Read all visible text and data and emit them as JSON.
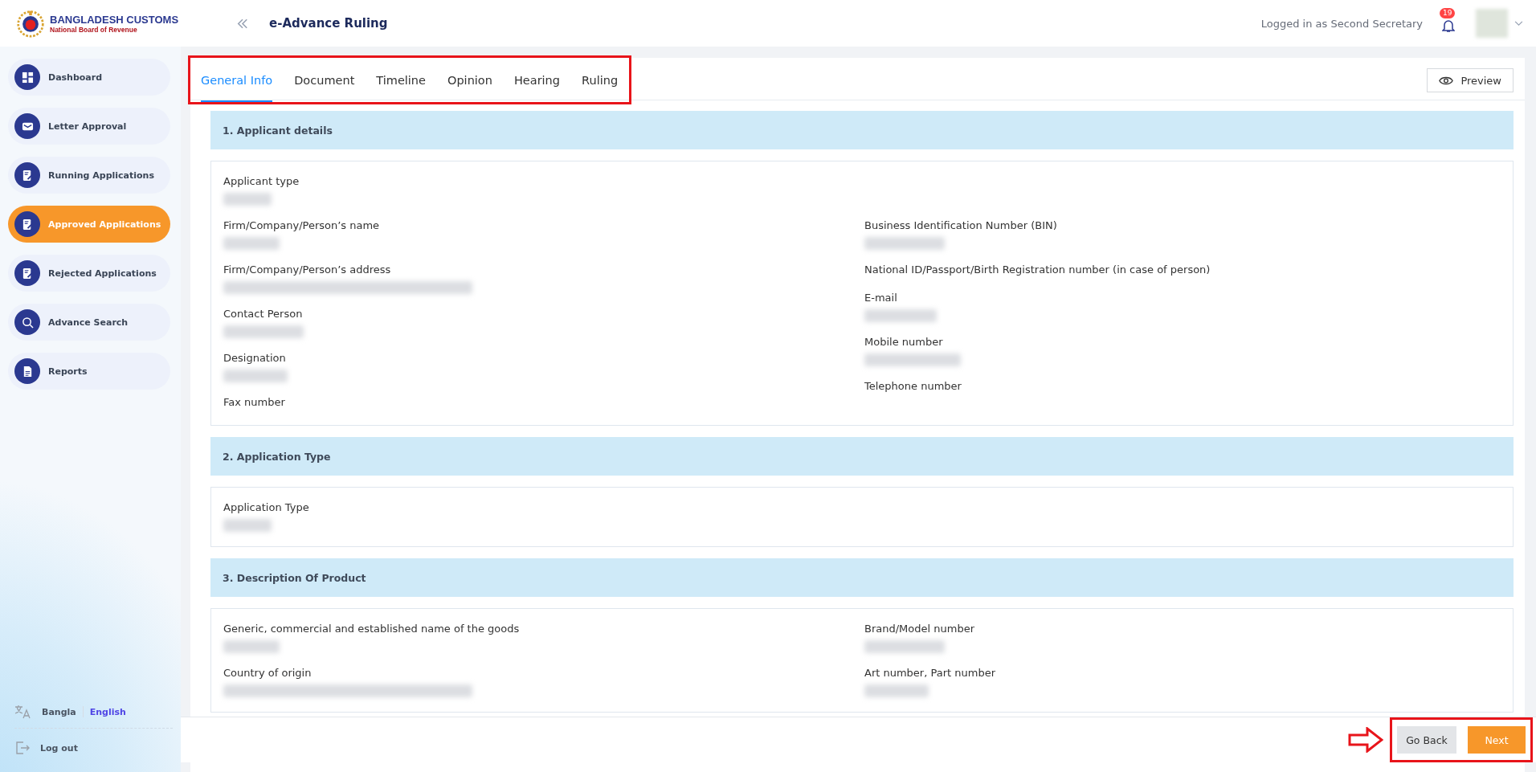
{
  "header": {
    "logo_title": "BANGLADESH CUSTOMS",
    "logo_subtitle": "National Board of Revenue",
    "page_title": "e-Advance Ruling",
    "user_status": "Logged in as Second Secretary",
    "notification_count": "19"
  },
  "sidebar": {
    "items": [
      {
        "label": "Dashboard",
        "kind": "grid",
        "selected": false
      },
      {
        "label": "Letter Approval",
        "kind": "mail",
        "selected": false
      },
      {
        "label": "Running Applications",
        "kind": "document",
        "selected": false
      },
      {
        "label": "Approved Applications",
        "kind": "document",
        "selected": true
      },
      {
        "label": "Rejected Applications",
        "kind": "document",
        "selected": false
      },
      {
        "label": "Advance Search",
        "kind": "search",
        "selected": false
      },
      {
        "label": "Reports",
        "kind": "report",
        "selected": false
      }
    ],
    "languages": [
      {
        "label": "Bangla",
        "selected": false
      },
      {
        "label": "English",
        "selected": true
      }
    ],
    "logout": "Log out"
  },
  "tabs": [
    {
      "label": "General Info",
      "selected": true
    },
    {
      "label": "Document",
      "selected": false
    },
    {
      "label": "Timeline",
      "selected": false
    },
    {
      "label": "Opinion",
      "selected": false
    },
    {
      "label": "Hearing",
      "selected": false
    },
    {
      "label": "Ruling",
      "selected": false
    }
  ],
  "preview_button": "Preview",
  "sections": [
    {
      "title": "1. Applicant details",
      "full_fields": [
        {
          "label": "Applicant type",
          "value_hidden": true
        }
      ],
      "left_fields": [
        {
          "label": "Firm/Company/Person’s name",
          "value_hidden": true
        },
        {
          "label": "Firm/Company/Person’s address",
          "value_hidden": true
        },
        {
          "label": "Contact Person",
          "value_hidden": true
        },
        {
          "label": "Designation",
          "value_hidden": true
        },
        {
          "label": "Fax number",
          "value_hidden": false
        }
      ],
      "right_fields": [
        {
          "label": "Business Identification Number (BIN)",
          "value_hidden": true
        },
        {
          "label": "National ID/Passport/Birth Registration number (in case of person)",
          "value_hidden": false
        },
        {
          "label": "E-mail",
          "value_hidden": true
        },
        {
          "label": "Mobile number",
          "value_hidden": true
        },
        {
          "label": "Telephone number",
          "value_hidden": false
        }
      ]
    },
    {
      "title": "2. Application Type",
      "full_fields": [
        {
          "label": "Application Type",
          "value_hidden": true
        }
      ]
    },
    {
      "title": "3. Description Of Product",
      "left_fields": [
        {
          "label": "Generic, commercial and established name of the goods",
          "value_hidden": true
        },
        {
          "label": "Country of origin",
          "value_hidden": true
        }
      ],
      "right_fields": [
        {
          "label": "Brand/Model number",
          "value_hidden": true
        },
        {
          "label": "Art number, Part number",
          "value_hidden": true
        }
      ]
    }
  ],
  "footer": {
    "buttons": [
      {
        "label": "Go Back",
        "kind": "secondary"
      },
      {
        "label": "Next",
        "kind": "primary"
      }
    ]
  }
}
